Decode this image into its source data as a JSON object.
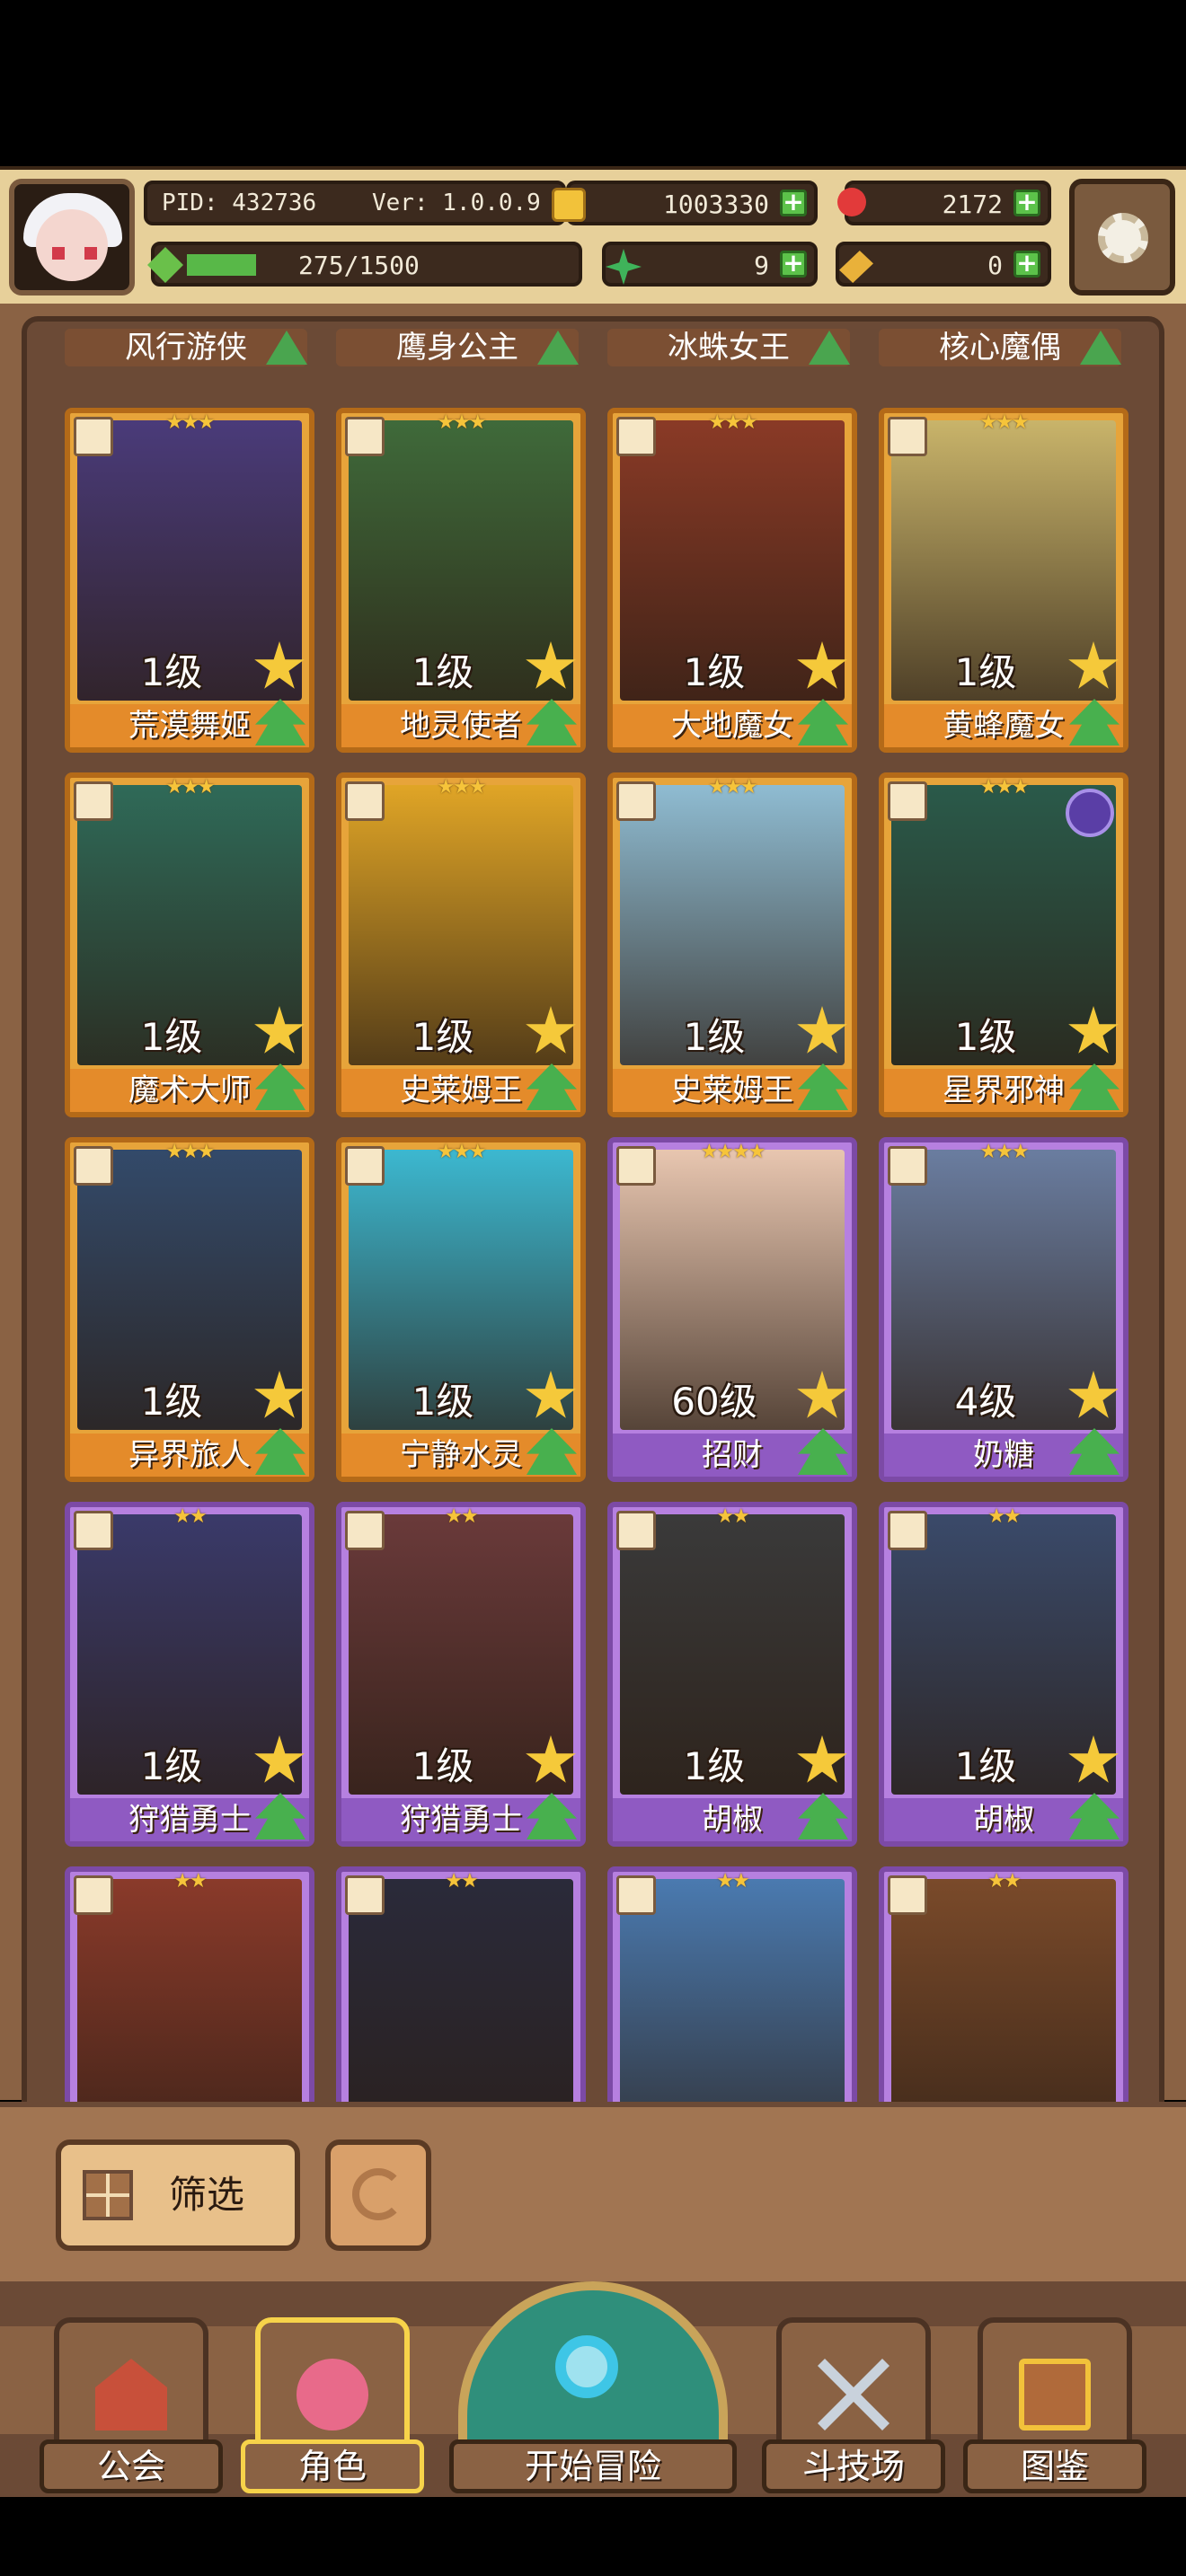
{
  "topbar": {
    "pid": "PID: 432736",
    "version": "Ver: 1.0.0.9",
    "coins": "1003330",
    "gems": "2172",
    "stamina": "275/1500",
    "stamina_progress": 0.183,
    "clovers": "9",
    "keys": "0"
  },
  "top_labels": [
    "风行游侠",
    "鹰身公主",
    "冰蛛女王",
    "核心魔偶"
  ],
  "characters": [
    {
      "level": "1级",
      "name": "荒漠舞姬",
      "rarity": "gold",
      "stars": "★★★",
      "art": "#4a3b7a"
    },
    {
      "level": "1级",
      "name": "地灵使者",
      "rarity": "gold",
      "stars": "★★★",
      "art": "#3f6a3a"
    },
    {
      "level": "1级",
      "name": "大地魔女",
      "rarity": "gold",
      "stars": "★★★",
      "art": "#8a3a26"
    },
    {
      "level": "1级",
      "name": "黄蜂魔女",
      "rarity": "gold",
      "stars": "★★★",
      "art": "#c9b46a"
    },
    {
      "level": "1级",
      "name": "魔术大师",
      "rarity": "gold",
      "stars": "★★★",
      "art": "#2f6a58"
    },
    {
      "level": "1级",
      "name": "史莱姆王",
      "rarity": "gold",
      "stars": "★★★",
      "art": "#e0a526"
    },
    {
      "level": "1级",
      "name": "史莱姆王",
      "rarity": "gold",
      "stars": "★★★",
      "art": "#8fbcd2"
    },
    {
      "level": "1级",
      "name": "星界邪神",
      "rarity": "gold",
      "stars": "★★★",
      "art": "#2a5a4a",
      "orb": true
    },
    {
      "level": "1级",
      "name": "异界旅人",
      "rarity": "gold",
      "stars": "★★★",
      "art": "#334a6a"
    },
    {
      "level": "1级",
      "name": "宁静水灵",
      "rarity": "gold",
      "stars": "★★★",
      "art": "#3cb8d0"
    },
    {
      "level": "60级",
      "name": "招财",
      "rarity": "purple",
      "stars": "★★★★",
      "art": "#e8c6b0"
    },
    {
      "level": "4级",
      "name": "奶糖",
      "rarity": "purple",
      "stars": "★★★",
      "art": "#6a7da0"
    },
    {
      "level": "1级",
      "name": "狩猎勇士",
      "rarity": "purple",
      "stars": "★★",
      "art": "#3a3a6a"
    },
    {
      "level": "1级",
      "name": "狩猎勇士",
      "rarity": "purple",
      "stars": "★★",
      "art": "#6a3a3a"
    },
    {
      "level": "1级",
      "name": "胡椒",
      "rarity": "purple",
      "stars": "★★",
      "art": "#3a3a3a"
    },
    {
      "level": "1级",
      "name": "胡椒",
      "rarity": "purple",
      "stars": "★★",
      "art": "#3a4a6a"
    },
    {
      "level": "",
      "name": "",
      "rarity": "purple",
      "stars": "★★",
      "art": "#8a3a2a"
    },
    {
      "level": "",
      "name": "",
      "rarity": "purple",
      "stars": "★★",
      "art": "#2a2a3a"
    },
    {
      "level": "",
      "name": "",
      "rarity": "purple",
      "stars": "★★",
      "art": "#4a7ab0"
    },
    {
      "level": "",
      "name": "",
      "rarity": "purple",
      "stars": "★★",
      "art": "#7a4a2a"
    }
  ],
  "filter": {
    "label": "筛选"
  },
  "nav": {
    "guild": "公会",
    "character": "角色",
    "adventure": "开始冒险",
    "arena": "斗技场",
    "codex": "图鉴"
  }
}
